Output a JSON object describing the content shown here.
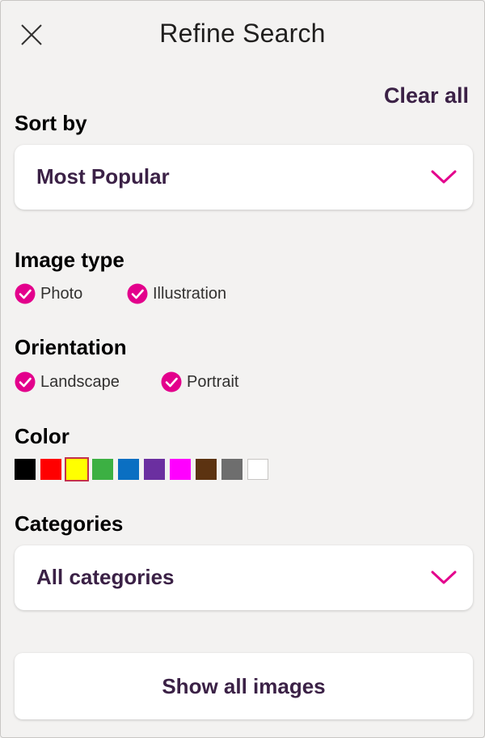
{
  "header": {
    "title": "Refine Search",
    "close_icon": "close-icon",
    "clear_all": "Clear all"
  },
  "sort": {
    "label": "Sort by",
    "selected": "Most Popular",
    "chevron_icon": "chevron-down-icon"
  },
  "image_type": {
    "label": "Image type",
    "options": [
      {
        "label": "Photo",
        "checked": true
      },
      {
        "label": "Illustration",
        "checked": true
      }
    ]
  },
  "orientation": {
    "label": "Orientation",
    "options": [
      {
        "label": "Landscape",
        "checked": true
      },
      {
        "label": "Portrait",
        "checked": true
      }
    ]
  },
  "color": {
    "label": "Color",
    "swatches": [
      {
        "name": "black",
        "hex": "#000000",
        "selected": false
      },
      {
        "name": "red",
        "hex": "#ff0000",
        "selected": false
      },
      {
        "name": "yellow",
        "hex": "#ffff00",
        "selected": true
      },
      {
        "name": "green",
        "hex": "#3cb043",
        "selected": false
      },
      {
        "name": "blue",
        "hex": "#0a6fc2",
        "selected": false
      },
      {
        "name": "purple",
        "hex": "#6b2fa0",
        "selected": false
      },
      {
        "name": "magenta",
        "hex": "#ff00ff",
        "selected": false
      },
      {
        "name": "brown",
        "hex": "#5c3311",
        "selected": false
      },
      {
        "name": "gray",
        "hex": "#6e6e6e",
        "selected": false
      },
      {
        "name": "white",
        "hex": "#ffffff",
        "selected": false
      }
    ]
  },
  "categories": {
    "label": "Categories",
    "selected": "All categories",
    "chevron_icon": "chevron-down-icon"
  },
  "footer": {
    "show_all": "Show all images"
  },
  "colors": {
    "accent": "#e3008c",
    "text_dark": "#3b2146",
    "background": "#f3f2f1"
  }
}
